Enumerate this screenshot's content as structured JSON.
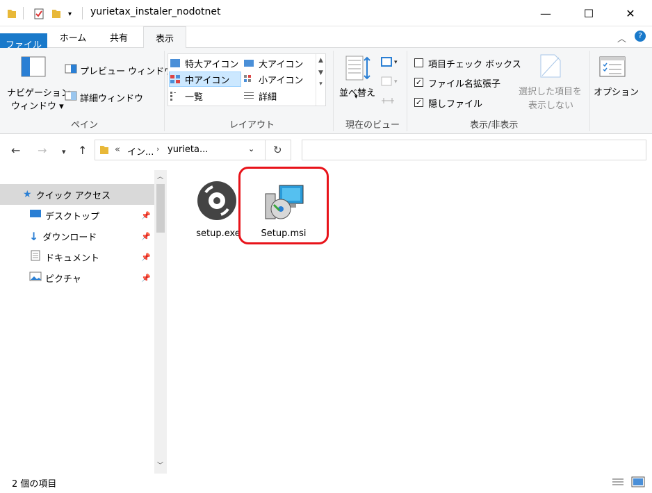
{
  "window": {
    "title": "yurietax_instaler_nodotnet",
    "minimize_glyph": "—",
    "maximize_glyph": "☐",
    "close_glyph": "✕"
  },
  "tabs": [
    "ファイル",
    "ホーム",
    "共有",
    "表示"
  ],
  "ribbon": {
    "pane": {
      "nav_pane_line1": "ナビゲーション",
      "nav_pane_line2": "ウィンドウ ▾",
      "preview_pane": "プレビュー ウィンドウ",
      "details_pane": "詳細ウィンドウ",
      "group_label": "ペイン"
    },
    "layout": {
      "items": [
        "特大アイコン",
        "大アイコン",
        "中アイコン",
        "小アイコン",
        "一覧",
        "詳細"
      ],
      "selected": "中アイコン",
      "group_label": "レイアウト"
    },
    "current_view": {
      "sort_label": "並べ替え",
      "group_label": "現在のビュー"
    },
    "show_hide": {
      "item_checkboxes": "項目チェック ボックス",
      "file_extensions": "ファイル名拡張子",
      "hidden_files": "隠しファイル",
      "hide_selected_line1": "選択した項目を",
      "hide_selected_line2": "表示しない",
      "group_label": "表示/非表示",
      "item_checkboxes_checked": false,
      "file_extensions_checked": true,
      "hidden_files_checked": true
    },
    "options_label": "オプション"
  },
  "address": {
    "breadcrumb_prefix": "«",
    "crumb1": "イン...",
    "crumb2": "yurieta...",
    "search_placeholder": ""
  },
  "nav_pane": {
    "items": [
      {
        "label": "クイック アクセス"
      },
      {
        "label": "デスクトップ"
      },
      {
        "label": "ダウンロード"
      },
      {
        "label": "ドキュメント"
      },
      {
        "label": "ピクチャ"
      }
    ]
  },
  "files": [
    {
      "name": "setup.exe"
    },
    {
      "name": "Setup.msi"
    }
  ],
  "status": {
    "count_text": "2 個の項目"
  },
  "colors": {
    "file_tab": "#1979ca",
    "highlight": "#e8131a",
    "selection": "#cce8ff"
  }
}
